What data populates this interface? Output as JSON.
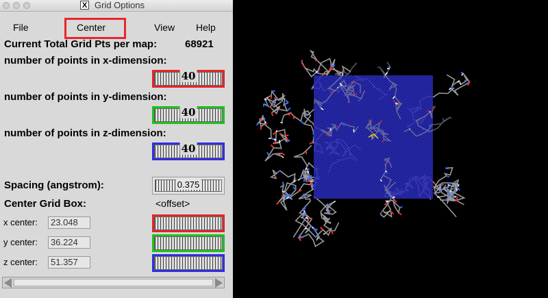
{
  "window": {
    "title": "Grid Options",
    "x_icon": "X"
  },
  "menu": {
    "file": "File",
    "center": "Center",
    "view": "View",
    "help": "Help"
  },
  "grid": {
    "total_label": "Current Total Grid Pts per map:",
    "total_value": "68921",
    "x_label": "number of points in x-dimension:",
    "x_value": "40",
    "y_label": "number of points in y-dimension:",
    "y_value": "40",
    "z_label": "number of points in z-dimension:",
    "z_value": "40"
  },
  "spacing": {
    "label": "Spacing (angstrom):",
    "value": "0.375"
  },
  "center_box": {
    "label": "Center Grid Box:",
    "offset": "<offset>",
    "x_label": "x center:",
    "x_value": "23.048",
    "y_label": "y center:",
    "y_value": "36.224",
    "z_label": "z center:",
    "z_value": "51.357"
  },
  "colors": {
    "x": "#e0262b",
    "y": "#1fc11f",
    "z": "#2f2fdf",
    "grid_box": "#2020a8",
    "highlight": "#e8262b"
  },
  "icons": {
    "close": "window-close-icon",
    "minimize": "window-minimize-icon",
    "zoom": "window-zoom-icon",
    "x11": "x11-icon"
  }
}
